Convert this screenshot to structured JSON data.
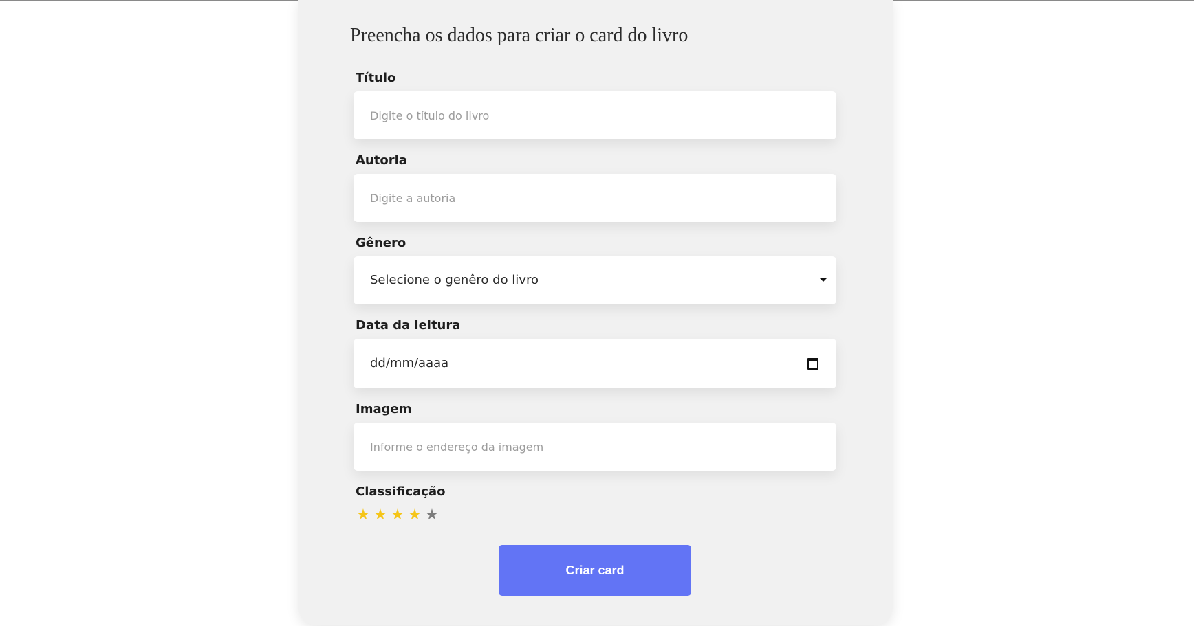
{
  "form": {
    "title": "Preencha os dados para criar o card do livro",
    "fields": {
      "titulo": {
        "label": "Título",
        "placeholder": "Digite o título do livro"
      },
      "autoria": {
        "label": "Autoria",
        "placeholder": "Digite a autoria"
      },
      "genero": {
        "label": "Gênero",
        "selected": "Selecione o genêro do livro"
      },
      "data": {
        "label": "Data da leitura",
        "value": "dd/mm/aaaa"
      },
      "imagem": {
        "label": "Imagem",
        "placeholder": "Informe o endereço da imagem"
      },
      "classificacao": {
        "label": "Classificação",
        "rating": 4,
        "max": 5
      }
    },
    "submit_label": "Criar card"
  },
  "colors": {
    "star_filled": "#f5c518",
    "star_empty": "#7d7d7d",
    "button": "#6274f5"
  },
  "icons": {
    "star": "★",
    "dropdown": "chevron-down-icon",
    "calendar": "calendar-icon"
  }
}
